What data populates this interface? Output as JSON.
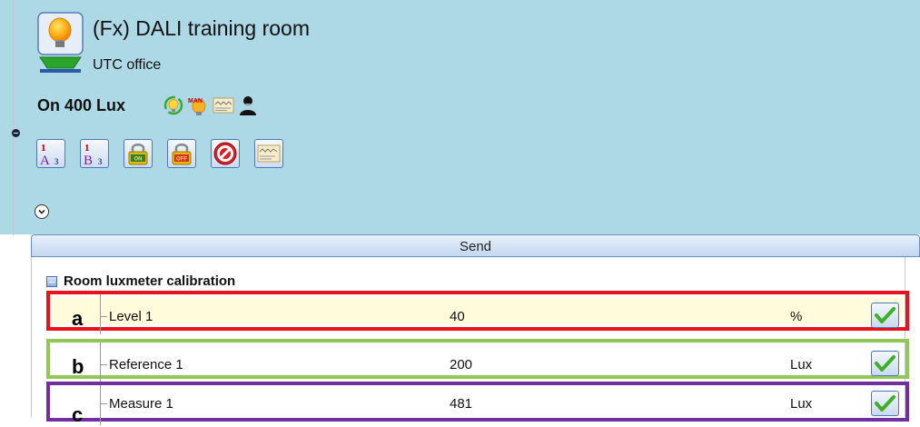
{
  "header": {
    "title": "(Fx) DALI training room",
    "subtitle": "UTC office",
    "status": "On 400 Lux",
    "status_icons": [
      "lightbulb-cycle-icon",
      "manual-bulb-icon",
      "chart-panel-icon",
      "user-icon"
    ]
  },
  "toolbar": {
    "buttons": [
      "scene-a-icon",
      "scene-b-icon",
      "lock-on-icon",
      "lock-off-icon",
      "stop-icon",
      "chart-panel-icon"
    ],
    "scene_a_text": "A",
    "scene_b_text": "B",
    "lock_on_text": "ON",
    "lock_off_text": "OFF",
    "num_top": "1",
    "num_bottom": "3"
  },
  "send": {
    "label": "Send"
  },
  "section": {
    "title": "Room luxmeter calibration"
  },
  "rows": [
    {
      "letter": "a",
      "label": "Level 1",
      "value": "40",
      "unit": "%",
      "border": "#e8111c",
      "bg": "#fffbdb"
    },
    {
      "letter": "b",
      "label": "Reference 1",
      "value": "200",
      "unit": "Lux",
      "border": "#92c955",
      "bg": "#ffffff"
    },
    {
      "letter": "c",
      "label": "Measure 1",
      "value": "481",
      "unit": "Lux",
      "border": "#7030a0",
      "bg": "#ffffff"
    }
  ],
  "colors": {
    "header_bg": "#add8e6",
    "check_green": "#3fae29"
  }
}
